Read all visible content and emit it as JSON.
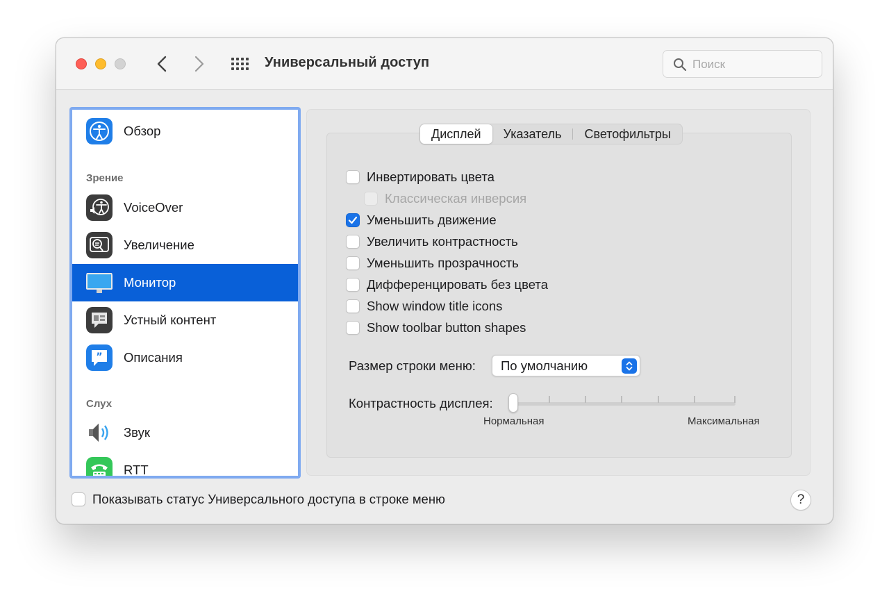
{
  "window": {
    "title": "Универсальный доступ",
    "search_placeholder": "Поиск"
  },
  "sidebar": {
    "items": [
      {
        "label": "Обзор",
        "icon": "accessibility-icon"
      },
      {
        "section": "Зрение"
      },
      {
        "label": "VoiceOver",
        "icon": "voiceover-icon"
      },
      {
        "label": "Увеличение",
        "icon": "zoom-icon"
      },
      {
        "label": "Монитор",
        "icon": "display-icon",
        "selected": true
      },
      {
        "label": "Устный контент",
        "icon": "spoken-content-icon"
      },
      {
        "label": "Описания",
        "icon": "descriptions-icon"
      },
      {
        "section": "Слух"
      },
      {
        "label": "Звук",
        "icon": "speaker-icon"
      },
      {
        "label": "RTT",
        "icon": "rtt-phone-icon"
      }
    ]
  },
  "tabs": [
    {
      "label": "Дисплей",
      "active": true
    },
    {
      "label": "Указатель",
      "active": false
    },
    {
      "label": "Светофильтры",
      "active": false
    }
  ],
  "options": [
    {
      "label": "Инвертировать цвета",
      "checked": false,
      "disabled": false
    },
    {
      "label": "Классическая инверсия",
      "checked": false,
      "disabled": true
    },
    {
      "label": "Уменьшить движение",
      "checked": true,
      "disabled": false
    },
    {
      "label": "Увеличить контрастность",
      "checked": false,
      "disabled": false
    },
    {
      "label": "Уменьшить прозрачность",
      "checked": false,
      "disabled": false
    },
    {
      "label": "Дифференцировать без цвета",
      "checked": false,
      "disabled": false
    },
    {
      "label": "Show window title icons",
      "checked": false,
      "disabled": false
    },
    {
      "label": "Show toolbar button shapes",
      "checked": false,
      "disabled": false
    }
  ],
  "menu_bar_size": {
    "label": "Размер строки меню:",
    "value": "По умолчанию"
  },
  "display_contrast": {
    "label": "Контрастность дисплея:",
    "min_label": "Нормальная",
    "max_label": "Максимальная",
    "value": 0
  },
  "footer": {
    "status_label": "Показывать статус Универсального доступа в строке меню",
    "status_checked": false,
    "help_label": "?"
  },
  "colors": {
    "accent": "#1a73e8",
    "selection": "#0960d8",
    "sidebar_focus": "#7faaf0"
  }
}
